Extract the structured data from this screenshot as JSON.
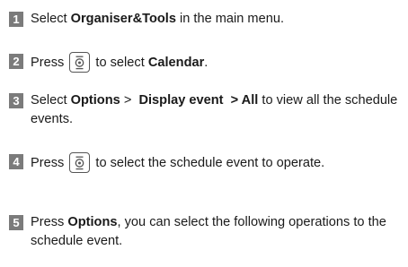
{
  "steps": [
    {
      "number": "1",
      "before": "Select ",
      "bold": "Organiser&Tools",
      "after": " in the main menu."
    },
    {
      "number": "2",
      "before": "Press ",
      "key_icon": "navigation-center-key-icon",
      "middle": " to select ",
      "bold": "Calendar",
      "after": "."
    },
    {
      "number": "3",
      "before": "Select ",
      "bold1": "Options",
      "sep1": " >  ",
      "bold2": "Display event  > All",
      "after": " to view all the schedule events."
    },
    {
      "number": "4",
      "before": "Press ",
      "key_icon": "navigation-center-key-icon",
      "after": " to select the schedule event to operate."
    },
    {
      "number": "5",
      "before": "Press ",
      "bold": "Options",
      "after": ", you can select the following operations to the schedule event."
    }
  ],
  "colors": {
    "badge_background": "#7b7b7b",
    "badge_text": "#ffffff",
    "body_text": "#1a1a1a",
    "icon_stroke": "#555555"
  }
}
